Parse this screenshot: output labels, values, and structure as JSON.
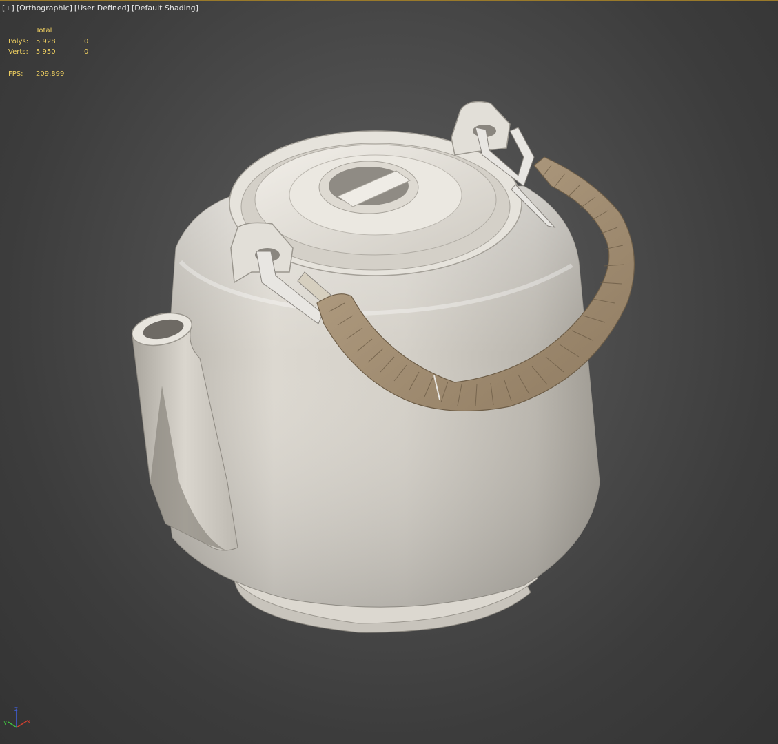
{
  "viewport": {
    "label_parts": [
      "[+]",
      "[Orthographic]",
      "[User Defined]",
      "[Default Shading]"
    ]
  },
  "stats": {
    "header_total": "Total",
    "polys_label": "Polys:",
    "polys_total": "5 928",
    "polys_selected": "0",
    "verts_label": "Verts:",
    "verts_total": "5 950",
    "verts_selected": "0",
    "fps_label": "FPS:",
    "fps_value": "209,899"
  },
  "colors": {
    "stats_text": "#f0d060",
    "label_text": "#e8e8e8",
    "border_accent": "#9a7a2a",
    "porcelain": "#d8d4cc",
    "wicker": "#a89276",
    "axis_x": "#d04030",
    "axis_y": "#40c040",
    "axis_z": "#4060e0"
  },
  "scene": {
    "object": "teapot-icon"
  }
}
